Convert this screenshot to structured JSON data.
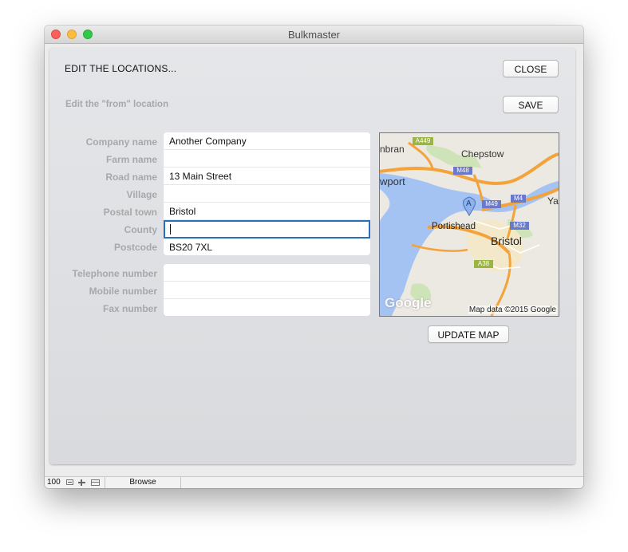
{
  "window": {
    "title": "Bulkmaster"
  },
  "header": {
    "title": "EDIT THE LOCATIONS...",
    "subtitle": "Edit the \"from\" location",
    "close_label": "CLOSE",
    "save_label": "SAVE"
  },
  "address_fields": [
    {
      "label": "Company name",
      "value": "Another Company"
    },
    {
      "label": "Farm name",
      "value": ""
    },
    {
      "label": "Road name",
      "value": "13 Main Street"
    },
    {
      "label": "Village",
      "value": ""
    },
    {
      "label": "Postal town",
      "value": "Bristol"
    },
    {
      "label": "County",
      "value": ""
    },
    {
      "label": "Postcode",
      "value": "BS20 7XL"
    }
  ],
  "contact_fields": [
    {
      "label": "Telephone number",
      "value": ""
    },
    {
      "label": "Mobile number",
      "value": ""
    },
    {
      "label": "Fax number",
      "value": ""
    }
  ],
  "map": {
    "labels": {
      "bristol": "Bristol",
      "portishead": "Portishead",
      "chepstow": "Chepstow",
      "newport": "wport",
      "caerphilly": "nbran",
      "yate": "Ya"
    },
    "roads": {
      "a449": "A449",
      "m48": "M48",
      "m49": "M49",
      "m4": "M4",
      "m32": "M32",
      "a38": "A38"
    },
    "marker": "A",
    "attribution": "Map data ©2015 Google",
    "logo": "Google",
    "update_label": "UPDATE MAP",
    "colors": {
      "water": "#a4c2f2",
      "land": "#eceae2",
      "motorway": "#f3a339",
      "motorway_badge": "#6b79c9",
      "a_road_badge": "#9bb545"
    }
  },
  "statusbar": {
    "zoom": "100",
    "mode": "Browse"
  }
}
